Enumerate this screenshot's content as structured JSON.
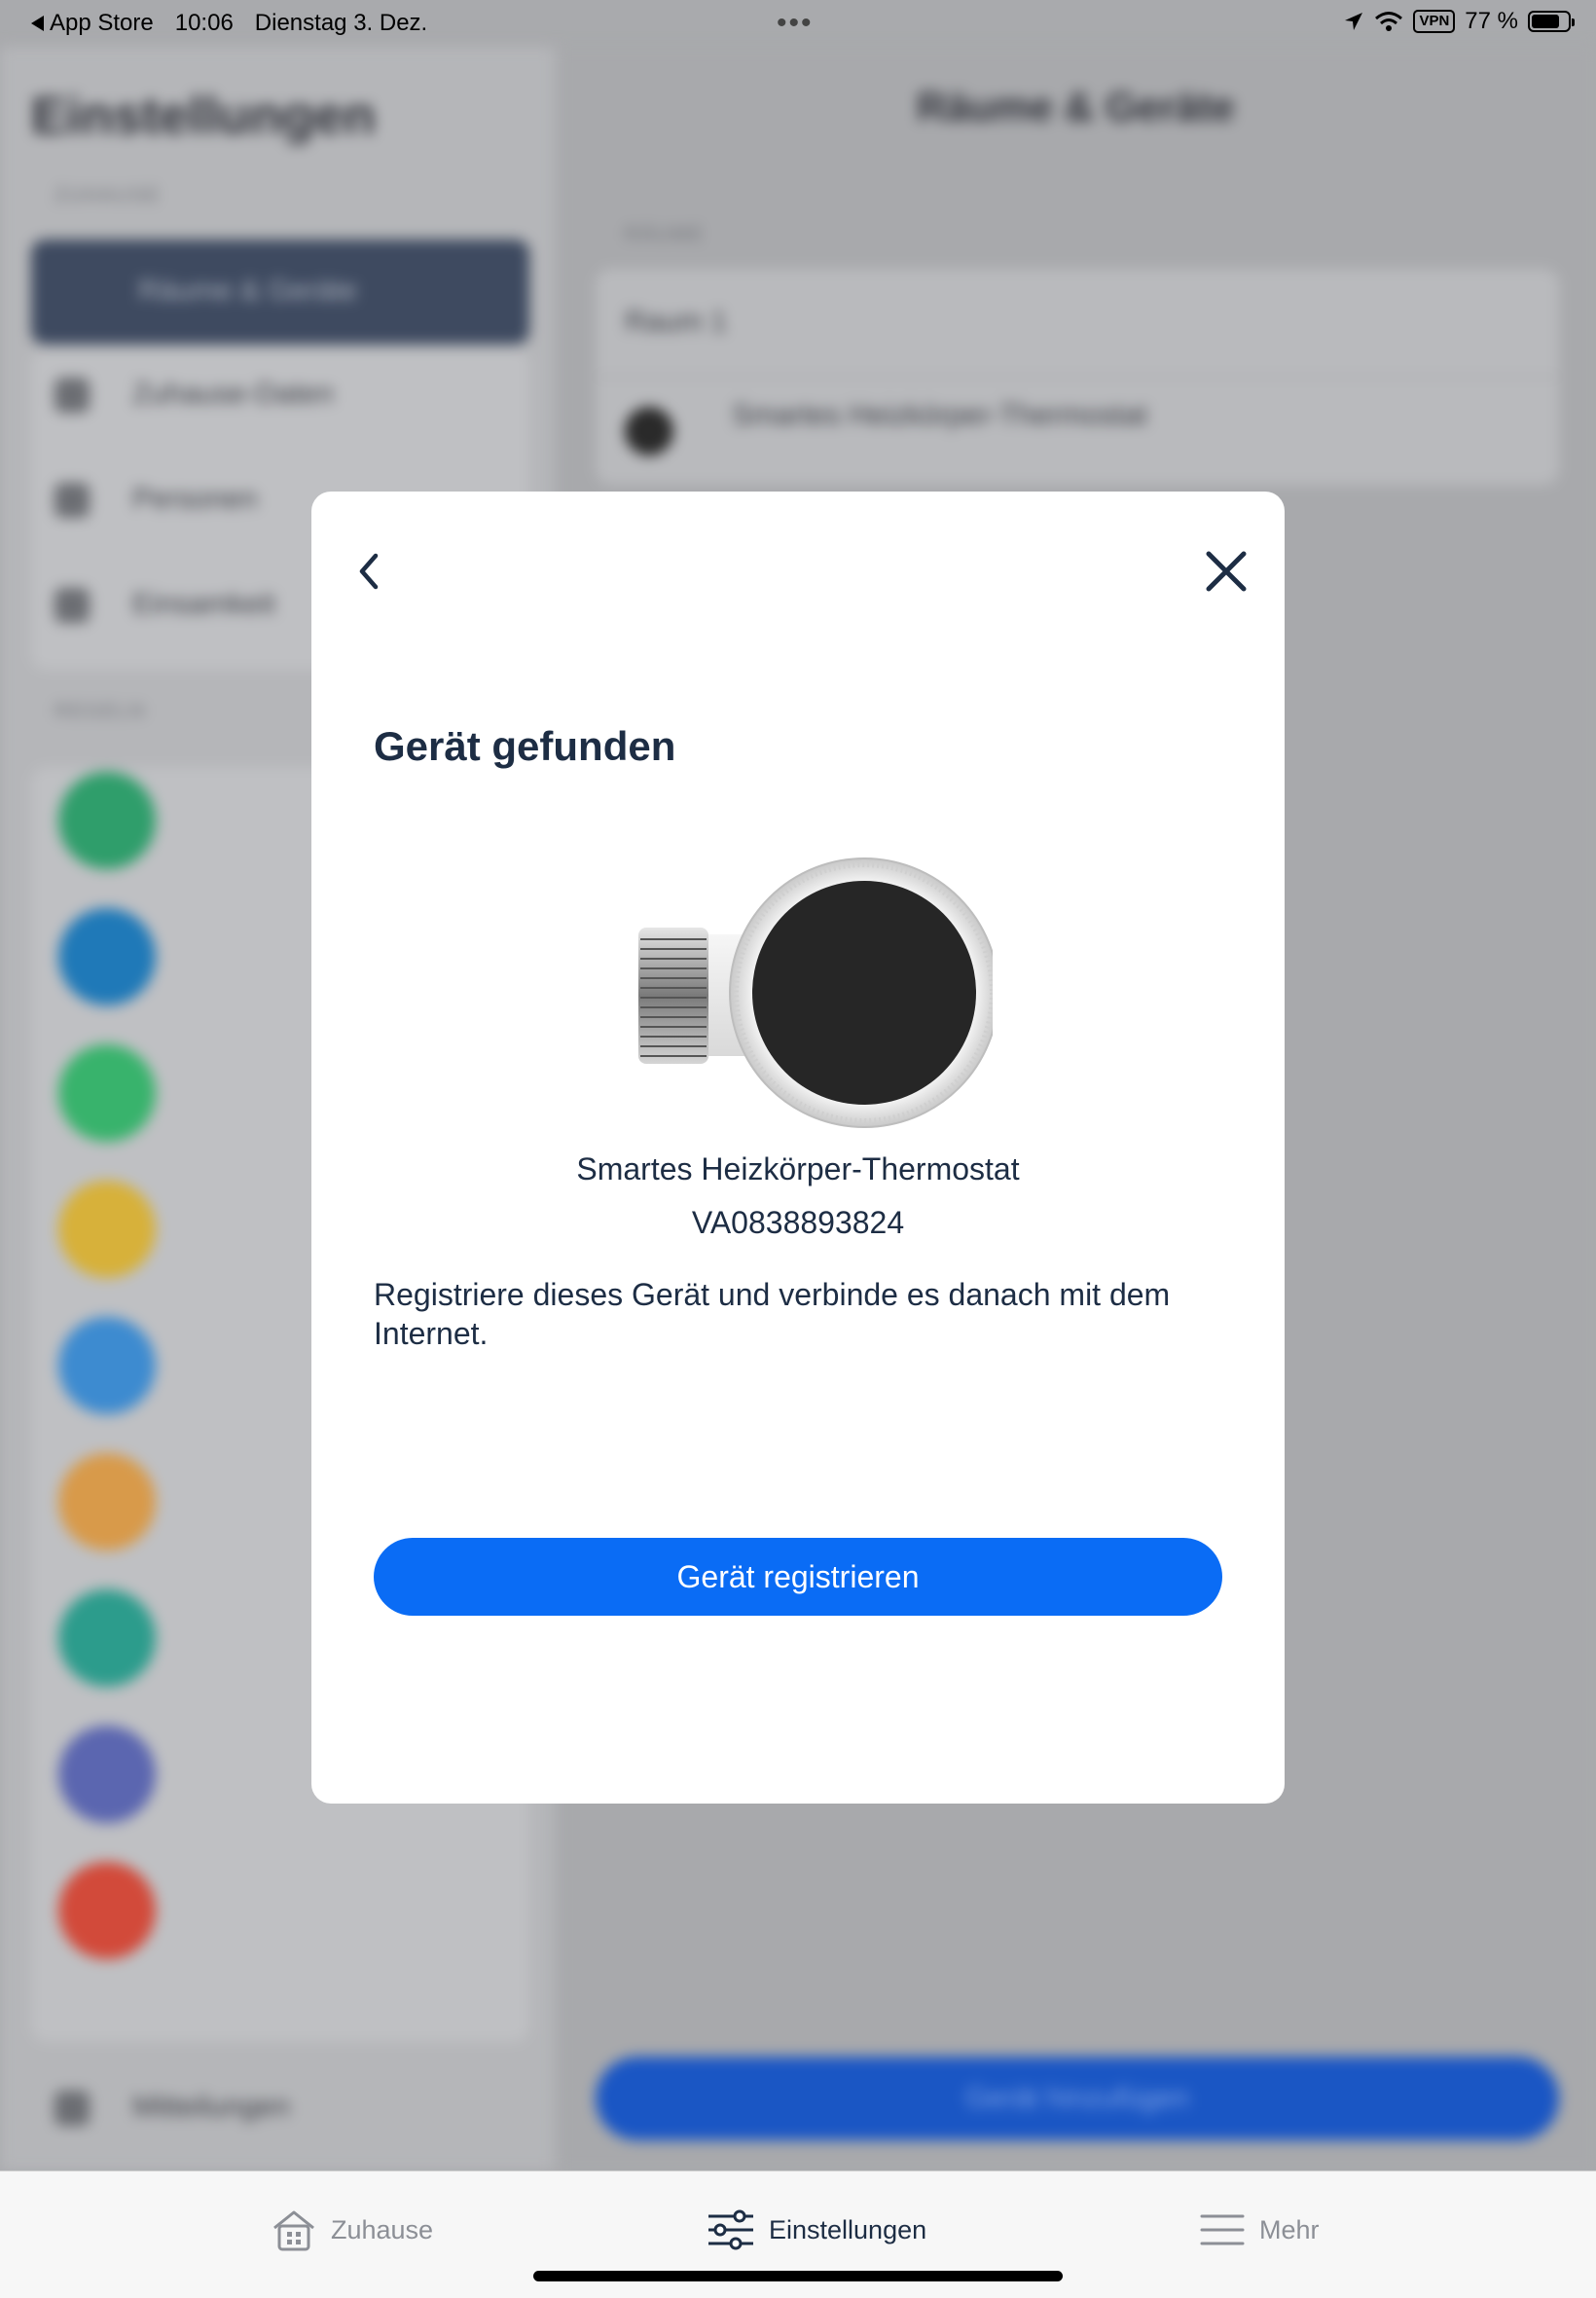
{
  "status_bar": {
    "back_app": "App Store",
    "time": "10:06",
    "date": "Dienstag 3. Dez.",
    "multitask_dots": "•••",
    "vpn_label": "VPN",
    "battery_text": "77 %",
    "battery_level": 0.77
  },
  "background": {
    "sidebar_title": "Einstellungen",
    "main_title": "Räume & Geräte",
    "sidebar_section_1": "ZUHAUSE",
    "sidebar_selected_item": "Räume & Geräte",
    "sidebar_items": [
      "Zuhause-Daten",
      "Personen",
      "Einsamkeit"
    ],
    "sidebar_section_2": "REGELN",
    "main_section": "RÄUME",
    "room_name": "Raum 1",
    "room_device": "Smartes Heizkörper-Thermostat",
    "bottom_sidebar_item": "Mitteilungen",
    "add_device_button": "Gerät hinzufügen",
    "feature_colors": [
      "#2f9e6b",
      "#1f79b8",
      "#38b36c",
      "#d7b13a",
      "#3d8bd0",
      "#d89a4a",
      "#2c9c8c",
      "#5b66b0",
      "#d24a3a"
    ]
  },
  "modal": {
    "back_icon": "chevron-left-icon",
    "close_icon": "close-icon",
    "title": "Gerät gefunden",
    "device_name": "Smartes Heizkörper-Thermostat",
    "serial_number": "VA0838893824",
    "description": "Registriere dieses Gerät und verbinde es danach mit dem Internet.",
    "register_button": "Gerät registrieren",
    "accent_color": "#0a6cf5"
  },
  "tab_bar": {
    "tabs": [
      {
        "label": "Zuhause",
        "icon": "house-icon",
        "active": false
      },
      {
        "label": "Einstellungen",
        "icon": "sliders-icon",
        "active": true
      },
      {
        "label": "Mehr",
        "icon": "menu-icon",
        "active": false
      }
    ]
  }
}
